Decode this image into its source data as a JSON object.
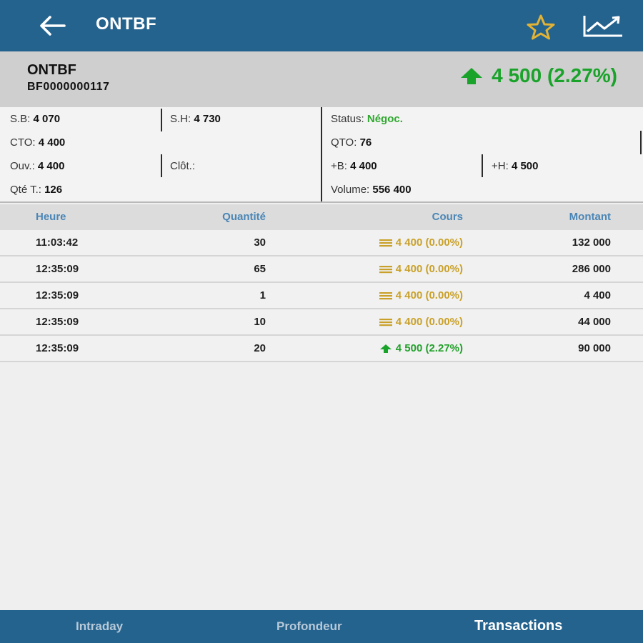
{
  "header": {
    "title": "ONTBF",
    "back_icon": "arrow-left-icon",
    "favorite_icon": "star-outline-icon",
    "chart_icon": "line-chart-icon"
  },
  "summary": {
    "symbol": "ONTBF",
    "isin": "BF0000000117",
    "price": "4 500 (2.27%)",
    "trend_icon": "arrow-up-icon",
    "price_color": "#1aa32a"
  },
  "info": {
    "sb_label": "S.B:",
    "sb_value": "4 070",
    "sh_label": "S.H:",
    "sh_value": "4 730",
    "cto_label": "CTO:",
    "cto_value": "4 400",
    "ouv_label": "Ouv.:",
    "ouv_value": "4 400",
    "clot_label": "Clôt.:",
    "clot_value": "",
    "qte_label": "Qté T.:",
    "qte_value": "126",
    "status_label": "Status:",
    "status_value": "Négoc.",
    "qto_label": "QTO:",
    "qto_value": "76",
    "plusb_label": "+B:",
    "plusb_value": "4 400",
    "plush_label": "+H:",
    "plush_value": "4 500",
    "volume_label": "Volume:",
    "volume_value": "556 400"
  },
  "table": {
    "headers": {
      "heure": "Heure",
      "quantite": "Quantité",
      "cours": "Cours",
      "montant": "Montant"
    },
    "rows": [
      {
        "heure": "11:03:42",
        "quantite": "30",
        "cours": "4 400 (0.00%)",
        "trend": "flat",
        "montant": "132 000"
      },
      {
        "heure": "12:35:09",
        "quantite": "65",
        "cours": "4 400 (0.00%)",
        "trend": "flat",
        "montant": "286 000"
      },
      {
        "heure": "12:35:09",
        "quantite": "1",
        "cours": "4 400 (0.00%)",
        "trend": "flat",
        "montant": "4 400"
      },
      {
        "heure": "12:35:09",
        "quantite": "10",
        "cours": "4 400 (0.00%)",
        "trend": "flat",
        "montant": "44 000"
      },
      {
        "heure": "12:35:09",
        "quantite": "20",
        "cours": "4 500 (2.27%)",
        "trend": "up",
        "montant": "90 000"
      }
    ]
  },
  "tabs": {
    "intraday": "Intraday",
    "profondeur": "Profondeur",
    "transactions": "Transactions",
    "active": "transactions"
  },
  "colors": {
    "primary": "#25638f",
    "up": "#1aa32a",
    "flat": "#c9a12a",
    "header_text": "#4a86b6"
  }
}
